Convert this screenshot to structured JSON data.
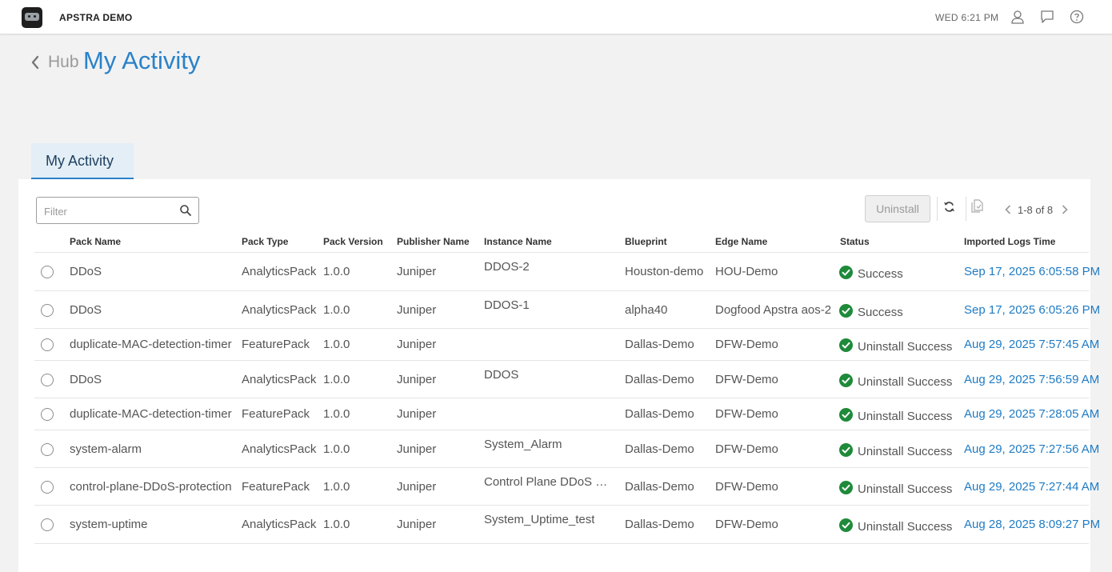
{
  "app": {
    "title": "APSTRA DEMO",
    "clock": "WED 6:21 PM"
  },
  "header": {
    "breadcrumb": "Hub",
    "title": "My Activity"
  },
  "tabs": [
    {
      "label": "My Activity"
    }
  ],
  "toolbar": {
    "filter_placeholder": "Filter",
    "uninstall_label": "Uninstall",
    "pagination": "1-8 of 8"
  },
  "table": {
    "columns": [
      "Pack Name",
      "Pack Type",
      "Pack Version",
      "Publisher Name",
      "Instance Name",
      "Blueprint",
      "Edge Name",
      "Status",
      "Imported Logs Time"
    ],
    "rows": [
      {
        "pack_name": "DDoS",
        "pack_type": "AnalyticsPack",
        "version": "1.0.0",
        "publisher": "Juniper",
        "instance": "DDOS-2",
        "blueprint": "Houston-demo",
        "edge": "HOU-Demo",
        "status": "Success",
        "time": "Sep 17, 2025 6:05:58 PM"
      },
      {
        "pack_name": "DDoS",
        "pack_type": "AnalyticsPack",
        "version": "1.0.0",
        "publisher": "Juniper",
        "instance": "DDOS-1",
        "blueprint": "alpha40",
        "edge": "Dogfood Apstra aos-2",
        "status": "Success",
        "time": "Sep 17, 2025 6:05:26 PM"
      },
      {
        "pack_name": "duplicate-MAC-detection-timer",
        "pack_type": "FeaturePack",
        "version": "1.0.0",
        "publisher": "Juniper",
        "instance": "",
        "blueprint": "Dallas-Demo",
        "edge": "DFW-Demo",
        "status": "Uninstall Success",
        "time": "Aug 29, 2025 7:57:45 AM"
      },
      {
        "pack_name": "DDoS",
        "pack_type": "AnalyticsPack",
        "version": "1.0.0",
        "publisher": "Juniper",
        "instance": "DDOS",
        "blueprint": "Dallas-Demo",
        "edge": "DFW-Demo",
        "status": "Uninstall Success",
        "time": "Aug 29, 2025 7:56:59 AM"
      },
      {
        "pack_name": "duplicate-MAC-detection-timer",
        "pack_type": "FeaturePack",
        "version": "1.0.0",
        "publisher": "Juniper",
        "instance": "",
        "blueprint": "Dallas-Demo",
        "edge": "DFW-Demo",
        "status": "Uninstall Success",
        "time": "Aug 29, 2025 7:28:05 AM"
      },
      {
        "pack_name": "system-alarm",
        "pack_type": "AnalyticsPack",
        "version": "1.0.0",
        "publisher": "Juniper",
        "instance": "System_Alarm",
        "blueprint": "Dallas-Demo",
        "edge": "DFW-Demo",
        "status": "Uninstall Success",
        "time": "Aug 29, 2025 7:27:56 AM"
      },
      {
        "pack_name": "control-plane-DDoS-protection",
        "pack_type": "FeaturePack",
        "version": "1.0.0",
        "publisher": "Juniper",
        "instance": "Control Plane DDoS Pr...",
        "blueprint": "Dallas-Demo",
        "edge": "DFW-Demo",
        "status": "Uninstall Success",
        "time": "Aug 29, 2025 7:27:44 AM"
      },
      {
        "pack_name": "system-uptime",
        "pack_type": "AnalyticsPack",
        "version": "1.0.0",
        "publisher": "Juniper",
        "instance": "System_Uptime_test",
        "blueprint": "Dallas-Demo",
        "edge": "DFW-Demo",
        "status": "Uninstall Success",
        "time": "Aug 28, 2025 8:09:27 PM"
      }
    ]
  },
  "colors": {
    "accent": "#2a82c9",
    "success": "#1e8a3a",
    "link": "#1f7bc4"
  },
  "icons": [
    "app-logo",
    "user-icon",
    "chat-icon",
    "help-icon",
    "chevron-left-icon",
    "search-icon",
    "refresh-icon",
    "export-icon",
    "success-check-icon"
  ]
}
